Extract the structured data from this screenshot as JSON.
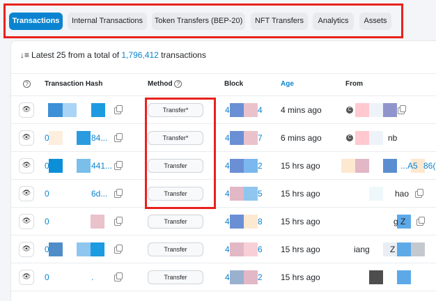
{
  "tabs": [
    {
      "label": "Transactions",
      "active": true
    },
    {
      "label": "Internal Transactions",
      "active": false
    },
    {
      "label": "Token Transfers (BEP-20)",
      "active": false
    },
    {
      "label": "NFT Transfers",
      "active": false
    },
    {
      "label": "Analytics",
      "active": false
    },
    {
      "label": "Assets",
      "active": false
    }
  ],
  "summary": {
    "prefix": "Latest 25 from a total of ",
    "total": "1,796,412",
    "suffix": " transactions",
    "sort_icon": "sort-descending-icon"
  },
  "columns": {
    "info": "?",
    "hash": "Transaction Hash",
    "method": "Method",
    "block": "Block",
    "age": "Age",
    "from": "From"
  },
  "rows": [
    {
      "hash_start": "",
      "hash_end": "",
      "method": "Transfer*",
      "block_start": "4",
      "block_end": "4",
      "age": "4 mins ago",
      "from_text": "",
      "from_link": ""
    },
    {
      "hash_start": "0",
      "hash_end": "84...",
      "method": "Transfer*",
      "block_start": "4",
      "block_end": "7",
      "age": "6 mins ago",
      "from_text": "nb",
      "from_link": ""
    },
    {
      "hash_start": "0",
      "hash_end": "441...",
      "method": "Transfer",
      "block_start": "4",
      "block_end": "2",
      "age": "15 hrs ago",
      "from_text": "",
      "from_link": "...A5",
      "from_link2": "86("
    },
    {
      "hash_start": "0",
      "hash_end": "6d...",
      "method": "Transfer",
      "block_start": "4",
      "block_end": "5",
      "age": "15 hrs ago",
      "from_text": "hao",
      "from_link": ""
    },
    {
      "hash_start": "0",
      "hash_end": "",
      "method": "Transfer",
      "block_start": "4",
      "block_end": "8",
      "age": "15 hrs ago",
      "from_text": "g Z",
      "from_link": ""
    },
    {
      "hash_start": "0",
      "hash_end": "",
      "method": "Transfer",
      "block_start": "4",
      "block_end": "6",
      "age": "15 hrs ago",
      "from_text": "iang",
      "from_text2": "Z",
      "from_link": ""
    },
    {
      "hash_start": "0",
      "hash_end": ".",
      "method": "Transfer",
      "block_start": "4",
      "block_end": "2",
      "age": "15 hrs ago",
      "from_text": "",
      "from_link": ""
    }
  ],
  "icons": {
    "eye": "eye-icon",
    "copy": "copy-icon",
    "help": "question-circle-icon"
  },
  "colors": {
    "accent": "#0a84d0",
    "annotation": "#e8211d"
  }
}
